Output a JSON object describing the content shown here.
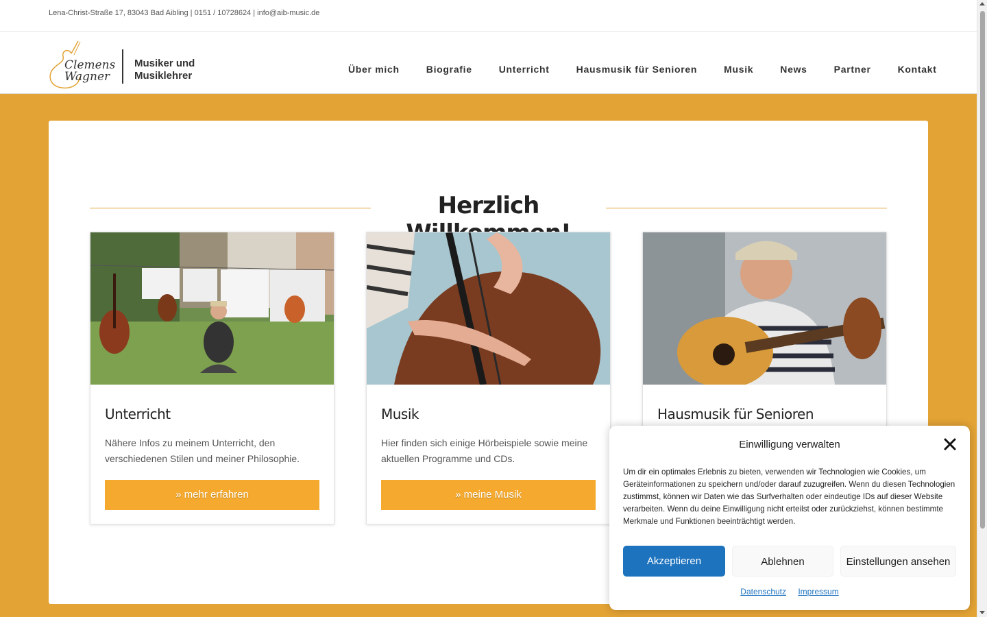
{
  "topbar": {
    "contact": "Lena-Christ-Straße 17, 83043 Bad Aibling | 0151 / 10728624 | info@aib-music.de"
  },
  "logo": {
    "name_line1": "Clemens",
    "name_line2": "Wagner",
    "tagline_line1": "Musiker und",
    "tagline_line2": "Musiklehrer"
  },
  "nav": {
    "items": [
      {
        "label": "Über mich"
      },
      {
        "label": "Biografie"
      },
      {
        "label": "Unterricht"
      },
      {
        "label": "Hausmusik für Senioren"
      },
      {
        "label": "Musik"
      },
      {
        "label": "News"
      },
      {
        "label": "Partner"
      },
      {
        "label": "Kontakt"
      }
    ]
  },
  "main": {
    "heading": "Herzlich Willkommen!",
    "cards": [
      {
        "title": "Unterricht",
        "text": "Nähere Infos zu meinem Unterricht, den verschiedenen Stilen und meiner Philosophie.",
        "button": "» mehr erfahren"
      },
      {
        "title": "Musik",
        "text": "Hier finden sich einige Hörbeispiele sowie meine aktuellen Programme und CDs.",
        "button": "» meine Musik"
      },
      {
        "title": "Hausmusik für Senioren",
        "text": "",
        "button": ""
      }
    ]
  },
  "consent": {
    "title": "Einwilligung verwalten",
    "text": "Um dir ein optimales Erlebnis zu bieten, verwenden wir Technologien wie Cookies, um Geräteinformationen zu speichern und/oder darauf zuzugreifen. Wenn du diesen Technologien zustimmst, können wir Daten wie das Surfverhalten oder eindeutige IDs auf dieser Website verarbeiten. Wenn du deine Einwilligung nicht erteilst oder zurückziehst, können bestimmte Merkmale und Funktionen beeinträchtigt werden.",
    "accept": "Akzeptieren",
    "deny": "Ablehnen",
    "settings": "Einstellungen ansehen",
    "link_privacy": "Datenschutz",
    "link_imprint": "Impressum"
  },
  "colors": {
    "accent": "#e3a335",
    "button": "#f5aa2f",
    "consent_primary": "#1e73be"
  }
}
